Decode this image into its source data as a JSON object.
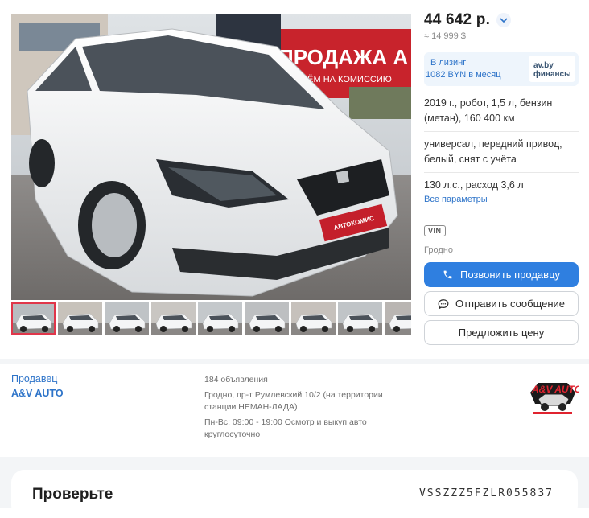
{
  "listing": {
    "price": "44 642 р.",
    "price_usd": "≈ 14 999 $",
    "leasing": {
      "title": "В лизинг",
      "amount": "1082 BYN в месяц",
      "partner_logo_line1": "av.by",
      "partner_logo_line2": "финансы"
    },
    "specs": {
      "line1": "2019 г., робот, 1,5 л, бензин (метан), 160 400 км",
      "line2": "универсал, передний привод, белый, снят с учёта",
      "line3": "130 л.с., расход 3,6 л"
    },
    "all_params_link": "Все параметры",
    "vin_badge": "VIN",
    "city": "Гродно"
  },
  "actions": {
    "call": "Позвонить продавцу",
    "message": "Отправить сообщение",
    "offer": "Предложить цену"
  },
  "photo": {
    "banner_text": "ПРОДАЖА А",
    "banner_sub": "ПРИЁМ НА КОМИССИЮ",
    "plate_text": "АВТОКОМИС",
    "thumbs_count": 9
  },
  "seller": {
    "label": "Продавец",
    "name": "A&V AUTO",
    "ads": "184 объявления",
    "address": "Гродно, пр-т Румлевский 10/2 (на территории станции НЕМАН-ЛАДА)",
    "hours": "Пн-Вс: 09:00 - 19:00 Осмотр и выкуп авто круглосуточно",
    "logo_text": "A&V AUTO"
  },
  "check": {
    "title": "Проверьте",
    "vin": "VSSZZZ5FZLR055837"
  },
  "colors": {
    "accent": "#2f7fe0",
    "link": "#2e74c9",
    "thumb_active": "#e0364a"
  }
}
